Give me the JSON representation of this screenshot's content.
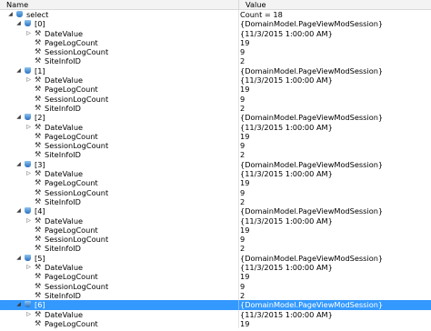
{
  "header": {
    "name": "Name",
    "value": "Value"
  },
  "rows": [
    {
      "level": 0,
      "expander": "expanded",
      "icon": "database-icon",
      "name": "select",
      "value": "Count = 18"
    },
    {
      "level": 1,
      "expander": "expanded",
      "icon": "object-icon",
      "name": "[0]",
      "value": "{DomainModel.PageViewModSession}"
    },
    {
      "level": 2,
      "expander": "collapsed",
      "icon": "wrench-icon",
      "name": "DateValue",
      "value": "{11/3/2015 1:00:00 AM}"
    },
    {
      "level": 2,
      "expander": "none",
      "icon": "wrench-icon",
      "name": "PageLogCount",
      "value": "19"
    },
    {
      "level": 2,
      "expander": "none",
      "icon": "wrench-icon",
      "name": "SessionLogCount",
      "value": "9"
    },
    {
      "level": 2,
      "expander": "none",
      "icon": "wrench-icon",
      "name": "SiteInfoID",
      "value": "2"
    },
    {
      "level": 1,
      "expander": "expanded",
      "icon": "object-icon",
      "name": "[1]",
      "value": "{DomainModel.PageViewModSession}"
    },
    {
      "level": 2,
      "expander": "collapsed",
      "icon": "wrench-icon",
      "name": "DateValue",
      "value": "{11/3/2015 1:00:00 AM}"
    },
    {
      "level": 2,
      "expander": "none",
      "icon": "wrench-icon",
      "name": "PageLogCount",
      "value": "19"
    },
    {
      "level": 2,
      "expander": "none",
      "icon": "wrench-icon",
      "name": "SessionLogCount",
      "value": "9"
    },
    {
      "level": 2,
      "expander": "none",
      "icon": "wrench-icon",
      "name": "SiteInfoID",
      "value": "2"
    },
    {
      "level": 1,
      "expander": "expanded",
      "icon": "object-icon",
      "name": "[2]",
      "value": "{DomainModel.PageViewModSession}"
    },
    {
      "level": 2,
      "expander": "collapsed",
      "icon": "wrench-icon",
      "name": "DateValue",
      "value": "{11/3/2015 1:00:00 AM}"
    },
    {
      "level": 2,
      "expander": "none",
      "icon": "wrench-icon",
      "name": "PageLogCount",
      "value": "19"
    },
    {
      "level": 2,
      "expander": "none",
      "icon": "wrench-icon",
      "name": "SessionLogCount",
      "value": "9"
    },
    {
      "level": 2,
      "expander": "none",
      "icon": "wrench-icon",
      "name": "SiteInfoID",
      "value": "2"
    },
    {
      "level": 1,
      "expander": "expanded",
      "icon": "object-icon",
      "name": "[3]",
      "value": "{DomainModel.PageViewModSession}"
    },
    {
      "level": 2,
      "expander": "collapsed",
      "icon": "wrench-icon",
      "name": "DateValue",
      "value": "{11/3/2015 1:00:00 AM}"
    },
    {
      "level": 2,
      "expander": "none",
      "icon": "wrench-icon",
      "name": "PageLogCount",
      "value": "19"
    },
    {
      "level": 2,
      "expander": "none",
      "icon": "wrench-icon",
      "name": "SessionLogCount",
      "value": "9"
    },
    {
      "level": 2,
      "expander": "none",
      "icon": "wrench-icon",
      "name": "SiteInfoID",
      "value": "2"
    },
    {
      "level": 1,
      "expander": "expanded",
      "icon": "object-icon",
      "name": "[4]",
      "value": "{DomainModel.PageViewModSession}"
    },
    {
      "level": 2,
      "expander": "collapsed",
      "icon": "wrench-icon",
      "name": "DateValue",
      "value": "{11/3/2015 1:00:00 AM}"
    },
    {
      "level": 2,
      "expander": "none",
      "icon": "wrench-icon",
      "name": "PageLogCount",
      "value": "19"
    },
    {
      "level": 2,
      "expander": "none",
      "icon": "wrench-icon",
      "name": "SessionLogCount",
      "value": "9"
    },
    {
      "level": 2,
      "expander": "none",
      "icon": "wrench-icon",
      "name": "SiteInfoID",
      "value": "2"
    },
    {
      "level": 1,
      "expander": "expanded",
      "icon": "object-icon",
      "name": "[5]",
      "value": "{DomainModel.PageViewModSession}"
    },
    {
      "level": 2,
      "expander": "collapsed",
      "icon": "wrench-icon",
      "name": "DateValue",
      "value": "{11/3/2015 1:00:00 AM}"
    },
    {
      "level": 2,
      "expander": "none",
      "icon": "wrench-icon",
      "name": "PageLogCount",
      "value": "19"
    },
    {
      "level": 2,
      "expander": "none",
      "icon": "wrench-icon",
      "name": "SessionLogCount",
      "value": "9"
    },
    {
      "level": 2,
      "expander": "none",
      "icon": "wrench-icon",
      "name": "SiteInfoID",
      "value": "2"
    },
    {
      "level": 1,
      "expander": "expanded",
      "icon": "object-icon",
      "name": "[6]",
      "value": "{DomainModel.PageViewModSession}",
      "selected": true
    },
    {
      "level": 2,
      "expander": "collapsed",
      "icon": "wrench-icon",
      "name": "DateValue",
      "value": "{11/3/2015 1:00:00 AM}"
    },
    {
      "level": 2,
      "expander": "none",
      "icon": "wrench-icon",
      "name": "PageLogCount",
      "value": "19"
    }
  ],
  "colors": {
    "selection": "#3399ff",
    "header": "#f3f3f3"
  }
}
